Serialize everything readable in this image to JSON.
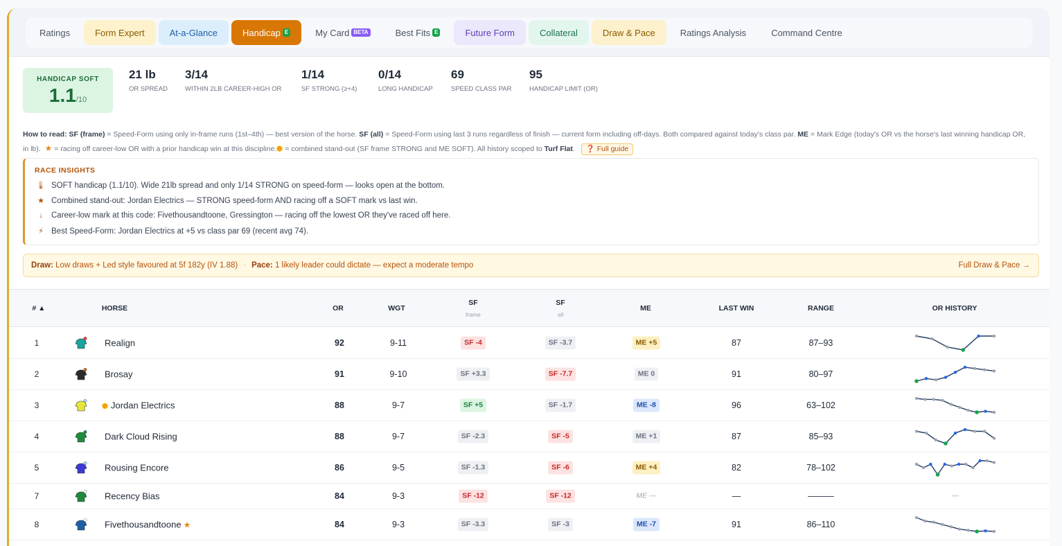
{
  "tabs": [
    {
      "label": "Ratings",
      "style": "plain"
    },
    {
      "label": "Form Expert",
      "style": "form"
    },
    {
      "label": "At-a-Glance",
      "style": "glance"
    },
    {
      "label": "Handicap",
      "badge": "E",
      "style": "handicap",
      "active": true
    },
    {
      "label": "My Card",
      "badge": "BETA",
      "style": "plain"
    },
    {
      "label": "Best Fits",
      "badge": "E",
      "style": "plain"
    },
    {
      "label": "Future Form",
      "style": "future"
    },
    {
      "label": "Collateral",
      "style": "collateral"
    },
    {
      "label": "Draw & Pace",
      "style": "draw"
    },
    {
      "label": "Ratings Analysis",
      "style": "plain"
    },
    {
      "label": "Command Centre",
      "style": "plain"
    }
  ],
  "summary": {
    "score_label": "HANDICAP SOFT",
    "score_value": "1.1",
    "score_denominator": "/10",
    "stats": [
      {
        "value": "21 lb",
        "label": "OR SPREAD"
      },
      {
        "value": "3/14",
        "label": "WITHIN 2LB CAREER-HIGH OR"
      },
      {
        "value": "1/14",
        "label": "SF STRONG (≥+4)"
      },
      {
        "value": "0/14",
        "label": "LONG HANDICAP"
      },
      {
        "value": "69",
        "label": "SPEED CLASS PAR"
      },
      {
        "value": "95",
        "label": "HANDICAP LIMIT (OR)"
      }
    ]
  },
  "howto": {
    "lead": "How to read:",
    "sf_frame_label": "SF (frame)",
    "sf_frame_text": "= Speed-Form using only in-frame runs (1st–4th) — best version of the horse.",
    "sf_all_label": "SF (all)",
    "sf_all_text": "= Speed-Form using last 3 runs regardless of finish — current form including off-days. Both compared against today's class par.",
    "me_label": "ME",
    "me_text": "= Mark Edge (today's OR vs the horse's last winning handicap OR, in lb).",
    "star_text": "= racing off career-low OR with a prior handicap win at this discipline.",
    "dot_text": "= combined stand-out (SF frame STRONG and ME SOFT). All history scoped to",
    "scope": "Turf Flat",
    "guide_button": "Full guide"
  },
  "insights": {
    "title": "RACE INSIGHTS",
    "items": [
      {
        "icon": "thermometer-icon",
        "glyph": "🌡",
        "text": "SOFT handicap (1.1/10). Wide 21lb spread and only 1/14 STRONG on speed-form — looks open at the bottom."
      },
      {
        "icon": "star-icon",
        "glyph": "★",
        "text": "Combined stand-out: Jordan Electrics — STRONG speed-form AND racing off a SOFT mark vs last win."
      },
      {
        "icon": "arrow-down-icon",
        "glyph": "↓",
        "text": "Career-low mark at this code: Fivethousandtoone, Gressington — racing off the lowest OR they've raced off here."
      },
      {
        "icon": "lightning-icon",
        "glyph": "⚡",
        "text": "Best Speed-Form: Jordan Electrics at +5 vs class par 69 (recent avg 74)."
      }
    ]
  },
  "drawpace": {
    "draw_label": "Draw:",
    "draw_text": "Low draws + Led style favoured at 5f 182y (IV 1.88)",
    "separator": "·",
    "pace_label": "Pace:",
    "pace_text": "1 likely leader could dictate — expect a moderate tempo",
    "link": "Full Draw & Pace →"
  },
  "table": {
    "headers": {
      "num": "# ▲",
      "horse": "HORSE",
      "or": "OR",
      "wgt": "WGT",
      "sf_frame": "SF",
      "sf_frame_sub": "frame",
      "sf_all": "SF",
      "sf_all_sub": "all",
      "me": "ME",
      "last_win": "LAST WIN",
      "range": "RANGE",
      "or_history": "OR HISTORY"
    },
    "rows": [
      {
        "num": "1",
        "horse": "Realign",
        "silk": [
          "#1ba39c",
          "#e53e3e"
        ],
        "or": "92",
        "wgt": "9-11",
        "sf_frame": "SF -4",
        "sf_frame_tone": "red",
        "sf_all": "SF -3.7",
        "sf_all_tone": "grey",
        "me": "ME +5",
        "me_tone": "yellow",
        "last_win": "87",
        "range": "87–93",
        "history": [
          92,
          91,
          88,
          87,
          92,
          92
        ]
      },
      {
        "num": "2",
        "horse": "Brosay",
        "silk": [
          "#2b2b2b",
          "#c0692a"
        ],
        "or": "91",
        "wgt": "9-10",
        "sf_frame": "SF +3.3",
        "sf_frame_tone": "grey",
        "sf_all": "SF -7.7",
        "sf_all_tone": "red",
        "me": "ME 0",
        "me_tone": "grey",
        "last_win": "91",
        "range": "80–97",
        "history": [
          83,
          85,
          84,
          86,
          90,
          94,
          93,
          92,
          91
        ]
      },
      {
        "num": "3",
        "horse": "Jordan Electrics",
        "silk": [
          "#e6e63a",
          "#9fd7ef"
        ],
        "dot": true,
        "or": "88",
        "wgt": "9-7",
        "sf_frame": "SF +5",
        "sf_frame_tone": "green",
        "sf_all": "SF -1.7",
        "sf_all_tone": "grey",
        "me": "ME -8",
        "me_tone": "blue",
        "last_win": "96",
        "range": "63–102",
        "history": [
          102,
          101,
          101,
          100,
          96,
          93,
          90,
          88,
          89,
          88
        ]
      },
      {
        "num": "4",
        "horse": "Dark Cloud Rising",
        "silk": [
          "#1e8a3c",
          "#1e8a3c"
        ],
        "or": "88",
        "wgt": "9-7",
        "sf_frame": "SF -2.3",
        "sf_frame_tone": "grey",
        "sf_all": "SF -5",
        "sf_all_tone": "red",
        "me": "ME +1",
        "me_tone": "grey",
        "last_win": "87",
        "range": "85–93",
        "history": [
          92,
          91,
          87,
          85,
          91,
          93,
          92,
          92,
          88
        ]
      },
      {
        "num": "5",
        "horse": "Rousing Encore",
        "silk": [
          "#3b3bd4",
          "#9fd7ef"
        ],
        "or": "86",
        "wgt": "9-5",
        "sf_frame": "SF -1.3",
        "sf_frame_tone": "grey",
        "sf_all": "SF -6",
        "sf_all_tone": "red",
        "me": "ME +4",
        "me_tone": "yellow",
        "last_win": "82",
        "range": "78–102",
        "history": [
          90,
          86,
          90,
          78,
          90,
          88,
          90,
          90,
          86,
          94,
          94,
          92
        ]
      },
      {
        "num": "7",
        "horse": "Recency Bias",
        "silk": [
          "#1e8a3c",
          "#ffffff"
        ],
        "or": "84",
        "wgt": "9-3",
        "sf_frame": "SF -12",
        "sf_frame_tone": "red",
        "sf_all": "SF -12",
        "sf_all_tone": "red",
        "me": "ME —",
        "me_tone": "none",
        "last_win": "—",
        "range": "———",
        "history_placeholder": "—"
      },
      {
        "num": "8",
        "horse": "Fivethousandtoone",
        "silk": [
          "#1d5fa6",
          "#ffffff"
        ],
        "star": true,
        "or": "84",
        "wgt": "9-3",
        "sf_frame": "SF -3.3",
        "sf_frame_tone": "grey",
        "sf_all": "SF -3",
        "sf_all_tone": "grey",
        "me": "ME -7",
        "me_tone": "blue",
        "last_win": "91",
        "range": "86–110",
        "history": [
          110,
          104,
          102,
          98,
          94,
          90,
          88,
          86,
          87,
          86
        ]
      }
    ]
  }
}
